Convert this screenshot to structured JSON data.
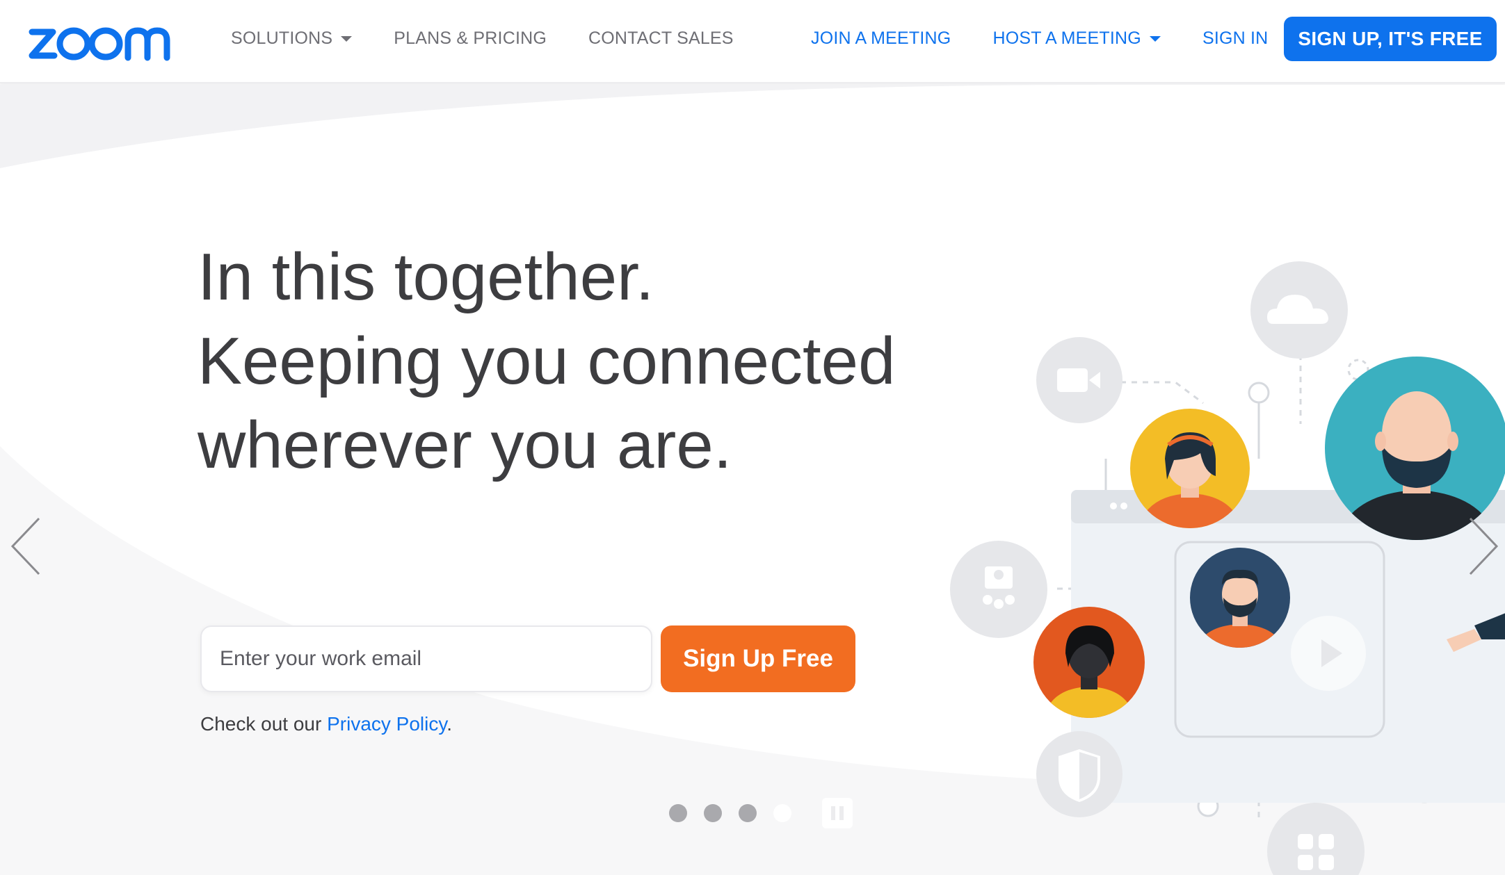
{
  "brand": {
    "logo_text": "zoom",
    "primary_color": "#0e72ed",
    "accent_color": "#f26d21"
  },
  "nav": {
    "left": [
      {
        "label": "SOLUTIONS",
        "dropdown": true
      },
      {
        "label": "PLANS & PRICING",
        "dropdown": false
      },
      {
        "label": "CONTACT SALES",
        "dropdown": false
      }
    ],
    "right": [
      {
        "label": "JOIN A MEETING",
        "dropdown": false
      },
      {
        "label": "HOST A MEETING",
        "dropdown": true
      },
      {
        "label": "SIGN IN",
        "dropdown": false
      }
    ],
    "signup_label": "SIGN UP, IT'S FREE"
  },
  "hero": {
    "headline_lines": [
      "In this together.",
      "Keeping you connected",
      "wherever you are."
    ],
    "email_placeholder": "Enter your work email",
    "email_value": "",
    "cta_label": "Sign Up Free",
    "privacy_prefix": "Check out our ",
    "privacy_link": "Privacy Policy",
    "privacy_suffix": "."
  },
  "carousel": {
    "slide_count": 4,
    "active_index": 3,
    "prev_icon": "chevron-left-icon",
    "next_icon": "chevron-right-icon",
    "pause_icon": "pause-icon"
  },
  "illustration": {
    "icons": [
      "cloud-icon",
      "video-camera-icon",
      "meeting-room-icon",
      "shield-icon",
      "play-icon",
      "apps-grid-icon"
    ],
    "avatars": [
      "avatar-woman-headband",
      "avatar-bald-bearded-man",
      "avatar-bearded-man",
      "avatar-dark-haired-person"
    ]
  }
}
